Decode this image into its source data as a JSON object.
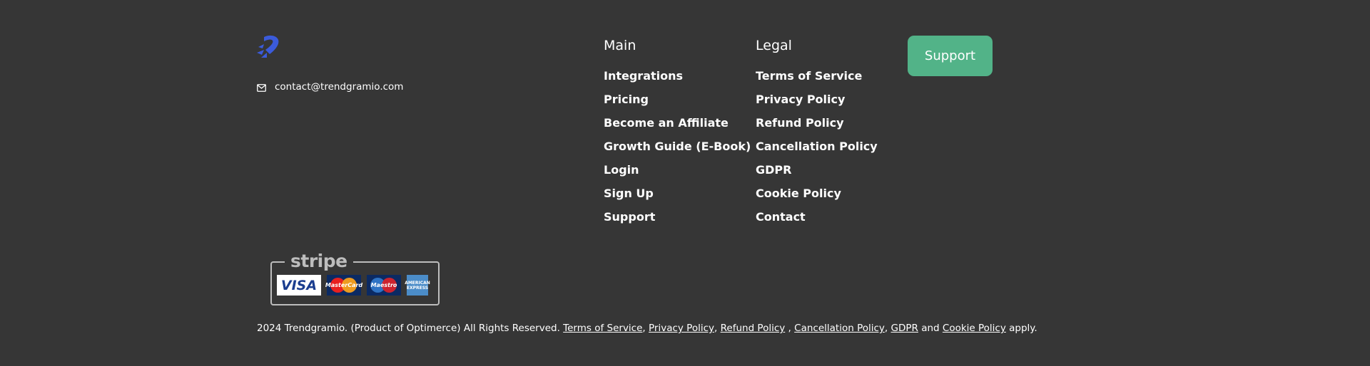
{
  "contact": {
    "email": "contact@trendgramio.com",
    "icon": "mail-icon"
  },
  "logo": {
    "icon": "rocket-logo-icon",
    "color": "#3b5bdb"
  },
  "main_column": {
    "heading": "Main",
    "items": [
      {
        "label": "Integrations"
      },
      {
        "label": "Pricing"
      },
      {
        "label": "Become an Affiliate"
      },
      {
        "label": "Growth Guide (E-Book)"
      },
      {
        "label": "Login"
      },
      {
        "label": "Sign Up"
      },
      {
        "label": "Support"
      }
    ]
  },
  "legal_column": {
    "heading": "Legal",
    "items": [
      {
        "label": "Terms of Service"
      },
      {
        "label": "Privacy Policy"
      },
      {
        "label": "Refund Policy"
      },
      {
        "label": "Cancellation Policy"
      },
      {
        "label": "GDPR"
      },
      {
        "label": "Cookie Policy"
      },
      {
        "label": "Contact"
      }
    ]
  },
  "support_button": {
    "label": "Support",
    "color": "#52b388"
  },
  "payment_badge": {
    "provider": "stripe",
    "cards": {
      "visa": "VISA",
      "mastercard": "MasterCard",
      "maestro": "Maestro",
      "amex": "AMERICAN EXPRESS"
    }
  },
  "copyright": {
    "prefix": "2024 Trendgramio. (Product of Optimerce) All Rights Reserved.",
    "links": {
      "terms": "Terms of Service",
      "privacy": "Privacy Policy",
      "refund": "Refund Policy",
      "cancellation": "Cancellation Policy",
      "gdpr": "GDPR",
      "cookie": "Cookie Policy"
    },
    "sep_comma": ",",
    "sep_space_comma": " ,",
    "and": "and",
    "suffix": "apply."
  },
  "colors": {
    "background": "#363636",
    "text": "#ffffff",
    "badge_border": "#bdbdbd"
  }
}
